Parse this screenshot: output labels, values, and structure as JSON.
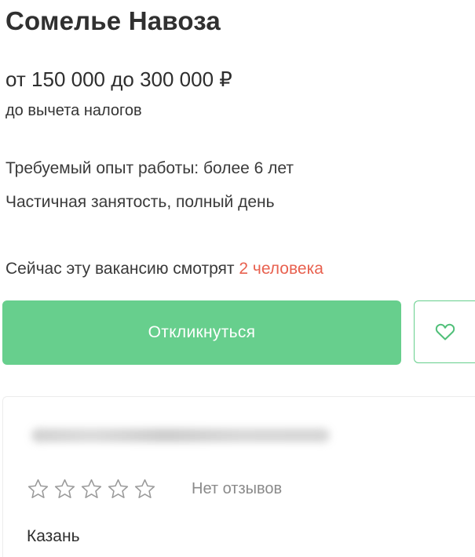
{
  "vacancy": {
    "title": "Сомелье Навоза",
    "salary": "от 150 000 до 300 000 ₽",
    "salary_note": "до вычета налогов",
    "experience": "Требуемый опыт работы: более 6 лет",
    "employment": "Частичная занятость, полный день",
    "viewers_prefix": "Сейчас эту вакансию смотрят",
    "viewers_count": "2 человека"
  },
  "actions": {
    "apply_label": "Откликнуться",
    "favorite_icon": "heart-icon"
  },
  "employer": {
    "rating_stars_filled": 0,
    "rating_stars_total": 5,
    "reviews_label": "Нет отзывов",
    "city": "Казань"
  },
  "colors": {
    "accent_green": "#67cf8d",
    "highlight_red": "#e8614f",
    "muted_text": "#8a8a8a"
  }
}
